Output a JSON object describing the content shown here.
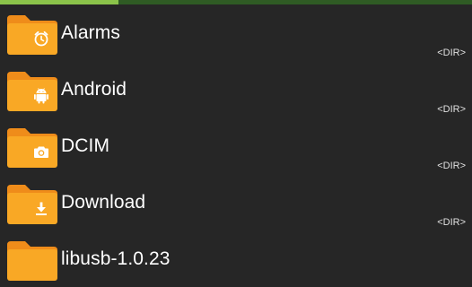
{
  "progress": {
    "fraction": 0.25,
    "track_color": "#2f5b24",
    "fill_color": "#8bc34a"
  },
  "folder_color": {
    "front": "#f9a825",
    "back": "#ef8c1a"
  },
  "files": [
    {
      "name": "Alarms",
      "size": "<DIR>",
      "icon": "alarm-clock-icon"
    },
    {
      "name": "Android",
      "size": "<DIR>",
      "icon": "android-icon"
    },
    {
      "name": "DCIM",
      "size": "<DIR>",
      "icon": "camera-icon"
    },
    {
      "name": "Download",
      "size": "<DIR>",
      "icon": "download-icon"
    },
    {
      "name": "libusb-1.0.23",
      "size": "",
      "icon": ""
    }
  ]
}
